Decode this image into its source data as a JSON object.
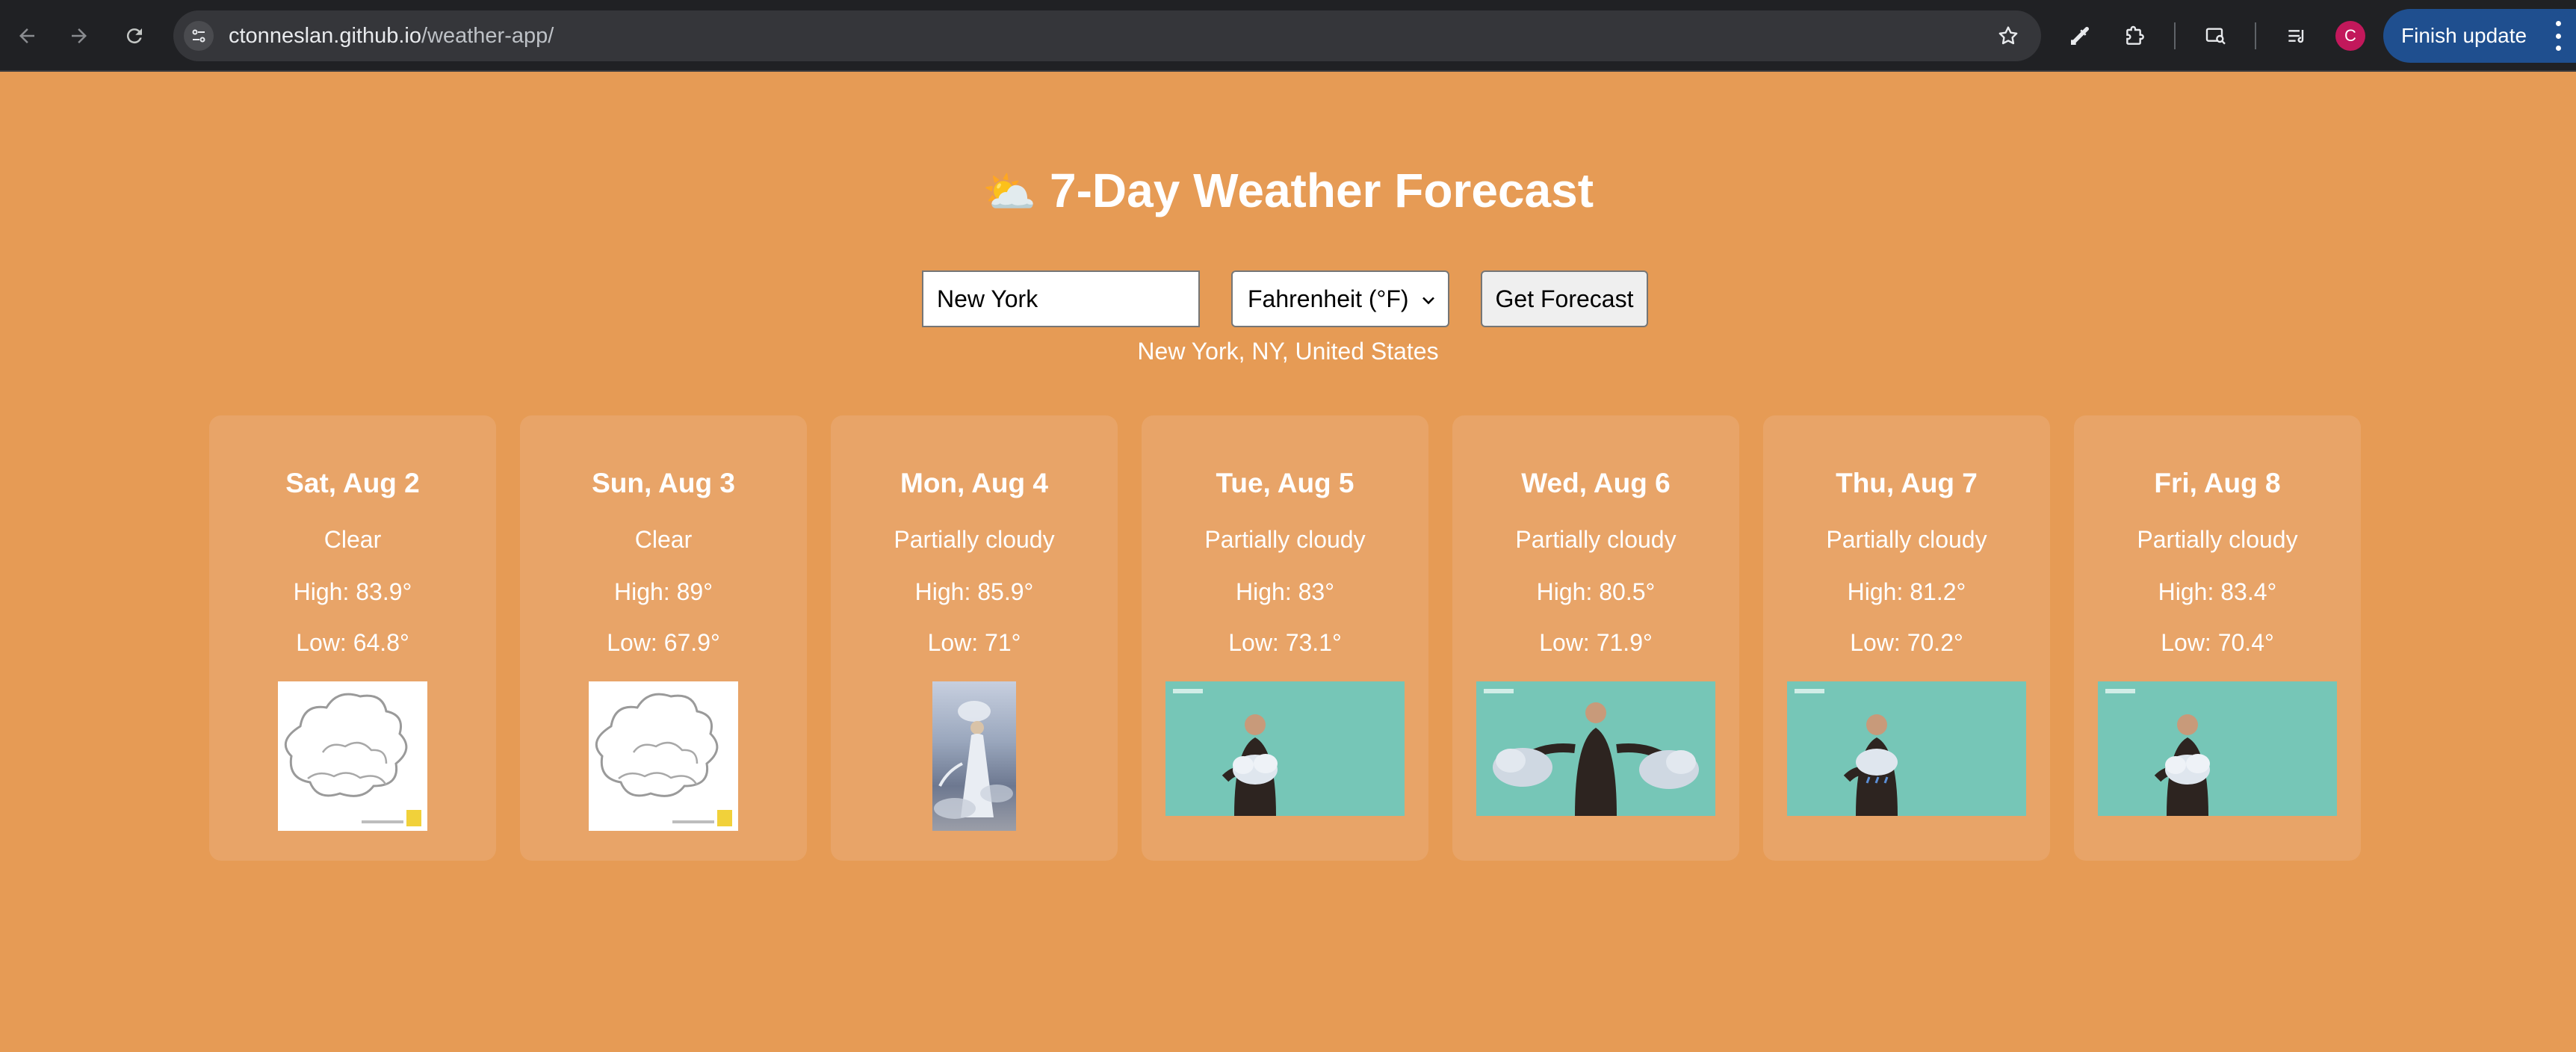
{
  "browser": {
    "url_host": "ctonneslan.github.io",
    "url_path": "/weather-app/",
    "avatar_letter": "C",
    "update_label": "Finish update"
  },
  "app": {
    "title_icon": "⛅",
    "title": "7-Day Weather Forecast",
    "city_value": "New York",
    "unit_selected": "Fahrenheit (°F)",
    "button_label": "Get Forecast",
    "location": "New York, NY, United States"
  },
  "forecast": [
    {
      "day": "Sat, Aug 2",
      "condition": "Clear",
      "high": "High: 83.9°",
      "low": "Low: 64.8°",
      "image": "cloud-outline"
    },
    {
      "day": "Sun, Aug 3",
      "condition": "Clear",
      "high": "High: 89°",
      "low": "Low: 67.9°",
      "image": "cloud-outline"
    },
    {
      "day": "Mon, Aug 4",
      "condition": "Partially cloudy",
      "high": "High: 85.9°",
      "low": "Low: 71°",
      "image": "fairy-in-clouds"
    },
    {
      "day": "Tue, Aug 5",
      "condition": "Partially cloudy",
      "high": "High: 83°",
      "low": "Low: 73.1°",
      "image": "presenter-cloud"
    },
    {
      "day": "Wed, Aug 6",
      "condition": "Partially cloudy",
      "high": "High: 80.5°",
      "low": "Low: 71.9°",
      "image": "presenter-two-clouds"
    },
    {
      "day": "Thu, Aug 7",
      "condition": "Partially cloudy",
      "high": "High: 81.2°",
      "low": "Low: 70.2°",
      "image": "presenter-rain-cloud"
    },
    {
      "day": "Fri, Aug 8",
      "condition": "Partially cloudy",
      "high": "High: 83.4°",
      "low": "Low: 70.4°",
      "image": "presenter-cloud"
    }
  ],
  "colors": {
    "page_bg": "#e69b55",
    "card_bg": "#e8a468",
    "gif_bg": "#76c6b7",
    "chrome_bg": "#202124"
  }
}
